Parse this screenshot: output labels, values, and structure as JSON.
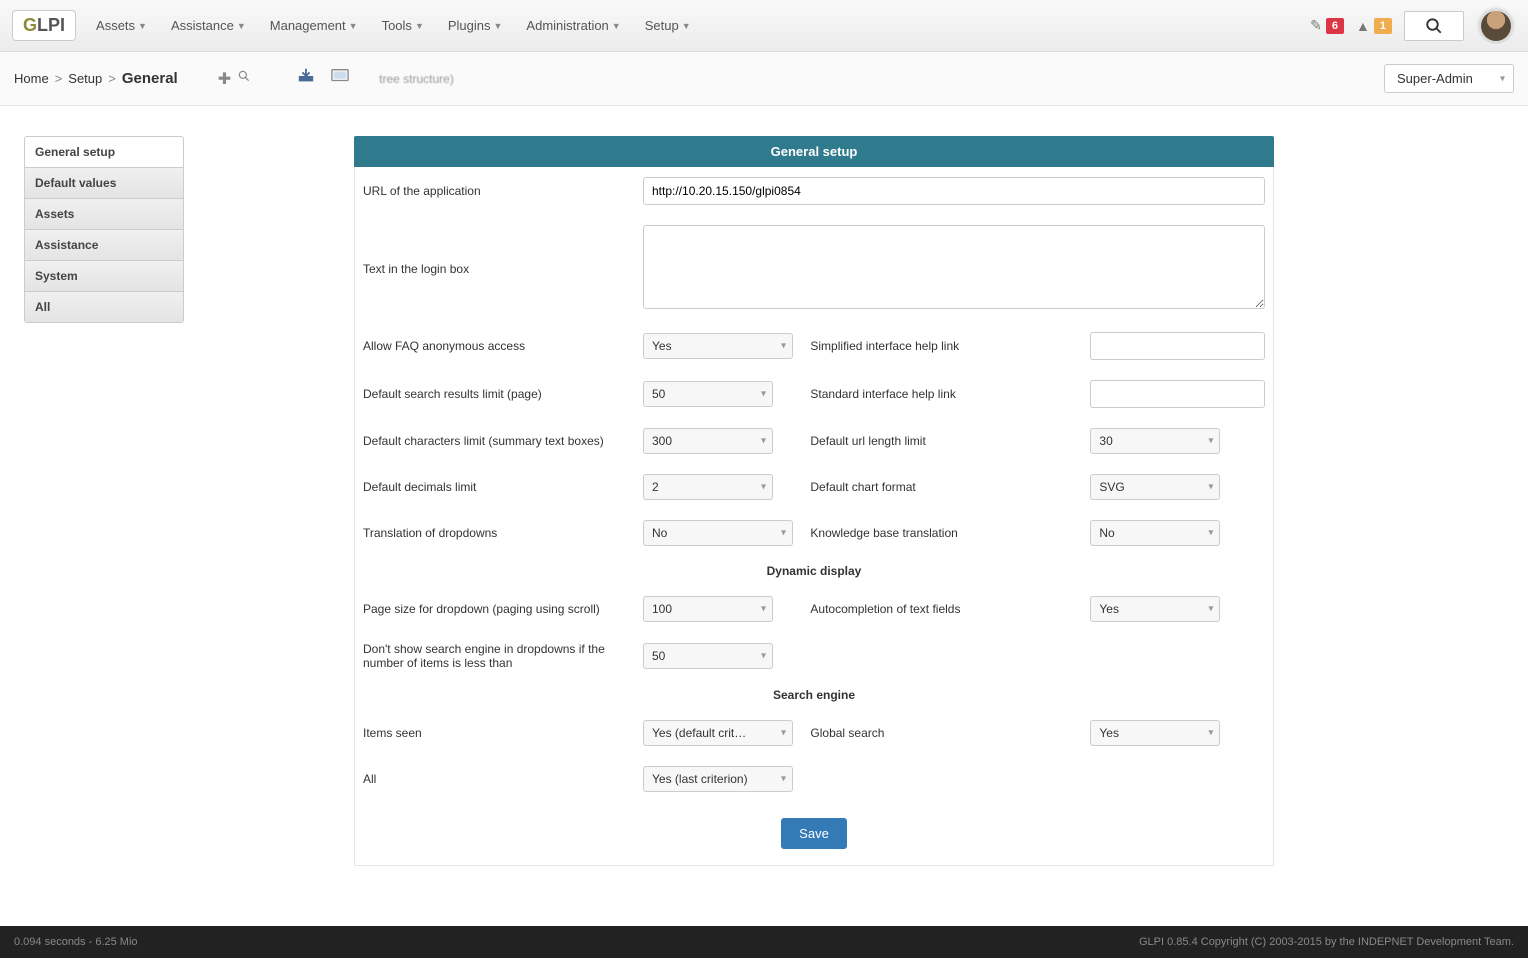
{
  "nav": {
    "items": [
      "Assets",
      "Assistance",
      "Management",
      "Tools",
      "Plugins",
      "Administration",
      "Setup"
    ]
  },
  "topright": {
    "badge1": "6",
    "badge2": "1"
  },
  "breadcrumb": {
    "home": "Home",
    "setup": "Setup",
    "current": "General",
    "tree": "tree structure)"
  },
  "profile": {
    "selected": "Super-Admin"
  },
  "sidebar": {
    "items": [
      {
        "label": "General setup",
        "active": true
      },
      {
        "label": "Default values"
      },
      {
        "label": "Assets"
      },
      {
        "label": "Assistance"
      },
      {
        "label": "System"
      },
      {
        "label": "All"
      }
    ]
  },
  "panel": {
    "title": "General setup"
  },
  "form": {
    "url_label": "URL of the application",
    "url_value": "http://10.20.15.150/glpi0854",
    "login_text_label": "Text in the login box",
    "login_text_value": "",
    "faq_label": "Allow FAQ anonymous access",
    "faq_value": "Yes",
    "simple_help_label": "Simplified interface help link",
    "simple_help_value": "",
    "search_limit_label": "Default search results limit (page)",
    "search_limit_value": "50",
    "std_help_label": "Standard interface help link",
    "std_help_value": "",
    "char_limit_label": "Default characters limit (summary text boxes)",
    "char_limit_value": "300",
    "url_len_label": "Default url length limit",
    "url_len_value": "30",
    "decimals_label": "Default decimals limit",
    "decimals_value": "2",
    "chart_fmt_label": "Default chart format",
    "chart_fmt_value": "SVG",
    "trans_dd_label": "Translation of dropdowns",
    "trans_dd_value": "No",
    "kb_trans_label": "Knowledge base translation",
    "kb_trans_value": "No",
    "section_dynamic": "Dynamic display",
    "page_size_label": "Page size for dropdown (paging using scroll)",
    "page_size_value": "100",
    "autocomp_label": "Autocompletion of text fields",
    "autocomp_value": "Yes",
    "no_search_label": "Don't show search engine in dropdowns if the number of items is less than",
    "no_search_value": "50",
    "section_search": "Search engine",
    "items_seen_label": "Items seen",
    "items_seen_value": "Yes (default crit…",
    "global_search_label": "Global search",
    "global_search_value": "Yes",
    "all_label": "All",
    "all_value": "Yes (last criterion)",
    "save": "Save"
  },
  "footer": {
    "left": "0.094 seconds - 6.25 Mio",
    "right": "GLPI 0.85.4 Copyright (C) 2003-2015 by the INDEPNET Development Team."
  }
}
